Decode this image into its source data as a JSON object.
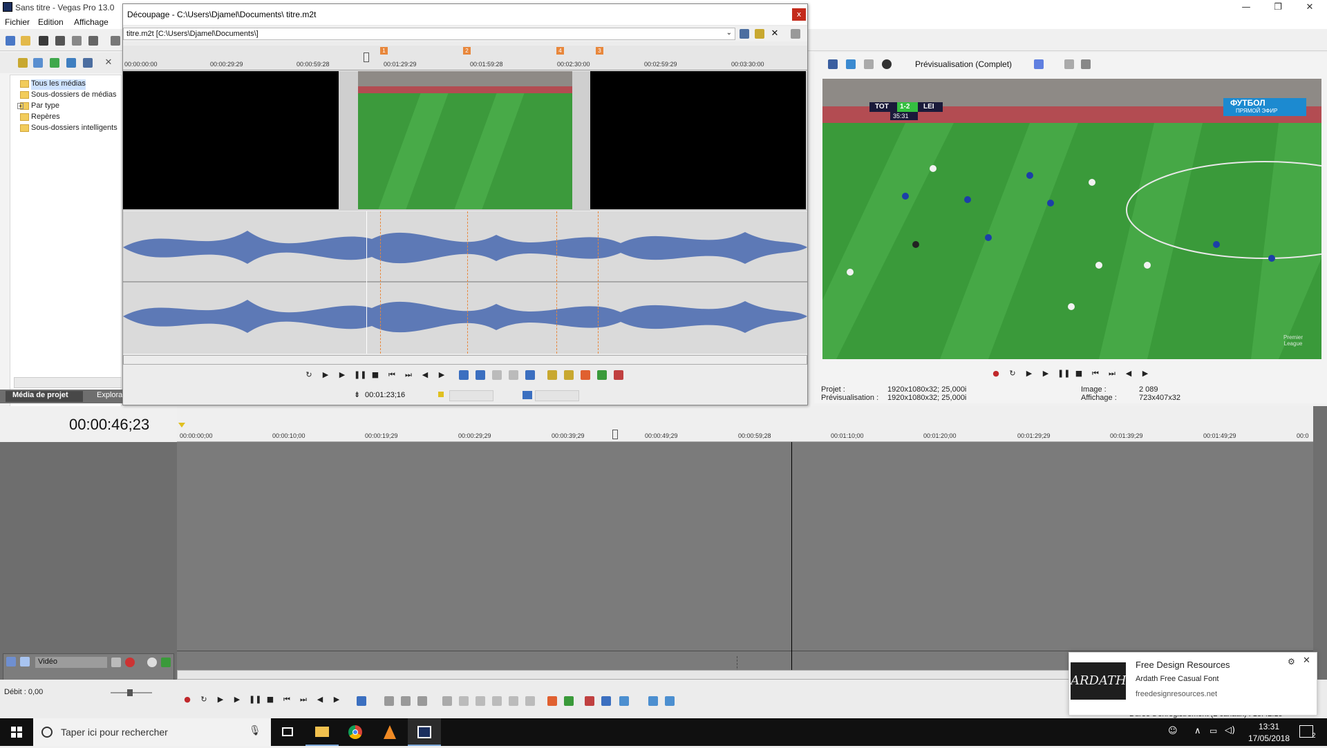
{
  "window": {
    "title": "Sans titre - Vegas Pro 13.0",
    "minimize": "—",
    "restore": "❐",
    "close": "✕"
  },
  "menu": {
    "items": [
      "Fichier",
      "Edition",
      "Affichage"
    ]
  },
  "project_media": {
    "tree": [
      "Tous les médias",
      "Sous-dossiers de médias",
      "Par type",
      "Repères",
      "Sous-dossiers intelligents"
    ],
    "tabs": [
      "Média de projet",
      "Explora"
    ]
  },
  "trimmer": {
    "title": "Découpage - C:\\Users\\Djamel\\Documents\\ titre.m2t",
    "combo_text": "titre.m2t   [C:\\Users\\Djamel\\Documents\\]",
    "close": "x",
    "ruler_ticks": [
      "00:00:00:00",
      "00:00:29:29",
      "00:00:59:28",
      "00:01:29:29",
      "00:01:59:28",
      "00:02:30:00",
      "00:02:59:29",
      "00:03:30:00"
    ],
    "markers": [
      "1",
      "2",
      "4",
      "3"
    ],
    "cursor_time": "00:01:23;16"
  },
  "preview": {
    "mode": "Prévisualisation (Complet)",
    "project_label": "Projet :",
    "project_value": "1920x1080x32; 25,000i",
    "preview_label": "Prévisualisation :",
    "preview_value": "1920x1080x32; 25,000i",
    "image_label": "Image :",
    "image_value": "2 089",
    "display_label": "Affichage :",
    "display_value": "723x407x32",
    "scoreboard_home": "TOT",
    "scoreboard_score": "1-2",
    "scoreboard_away": "LEI",
    "scoreboard_clock": "35:31",
    "channel_logo": "ФУТБОЛ",
    "channel_live": "ПРЯМОЙ ЭФИР",
    "watermark": "Premier League"
  },
  "timeline": {
    "timecode": "00:00:46;23",
    "ruler_ticks": [
      "00:00:00;00",
      "00:00:10;00",
      "00:00:19;29",
      "00:00:29;29",
      "00:00:39;29",
      "00:00:49;29",
      "00:00:59;28",
      "00:01:10;00",
      "00:01:20;00",
      "00:01:29;29",
      "00:01:39;29",
      "00:01:49;29",
      "00:0"
    ],
    "track_name": "Vidéo",
    "rate": "Débit : 0,00",
    "record_duration": "Durée d'enregistrement (2 canaux) : 18:42:15"
  },
  "notification": {
    "image_text": "ARDATH",
    "title": "Free Design Resources",
    "subtitle": "Ardath Free Casual Font",
    "url": "freedesignresources.net",
    "gear": "⚙",
    "close": "✕"
  },
  "taskbar": {
    "search_placeholder": "Taper ici pour rechercher",
    "time": "13:31",
    "date": "17/05/2018",
    "notification_count": "2"
  },
  "colors": {
    "waveform": "#5d79b6",
    "marker": "#e8873c",
    "accent": "#0a64b4"
  }
}
